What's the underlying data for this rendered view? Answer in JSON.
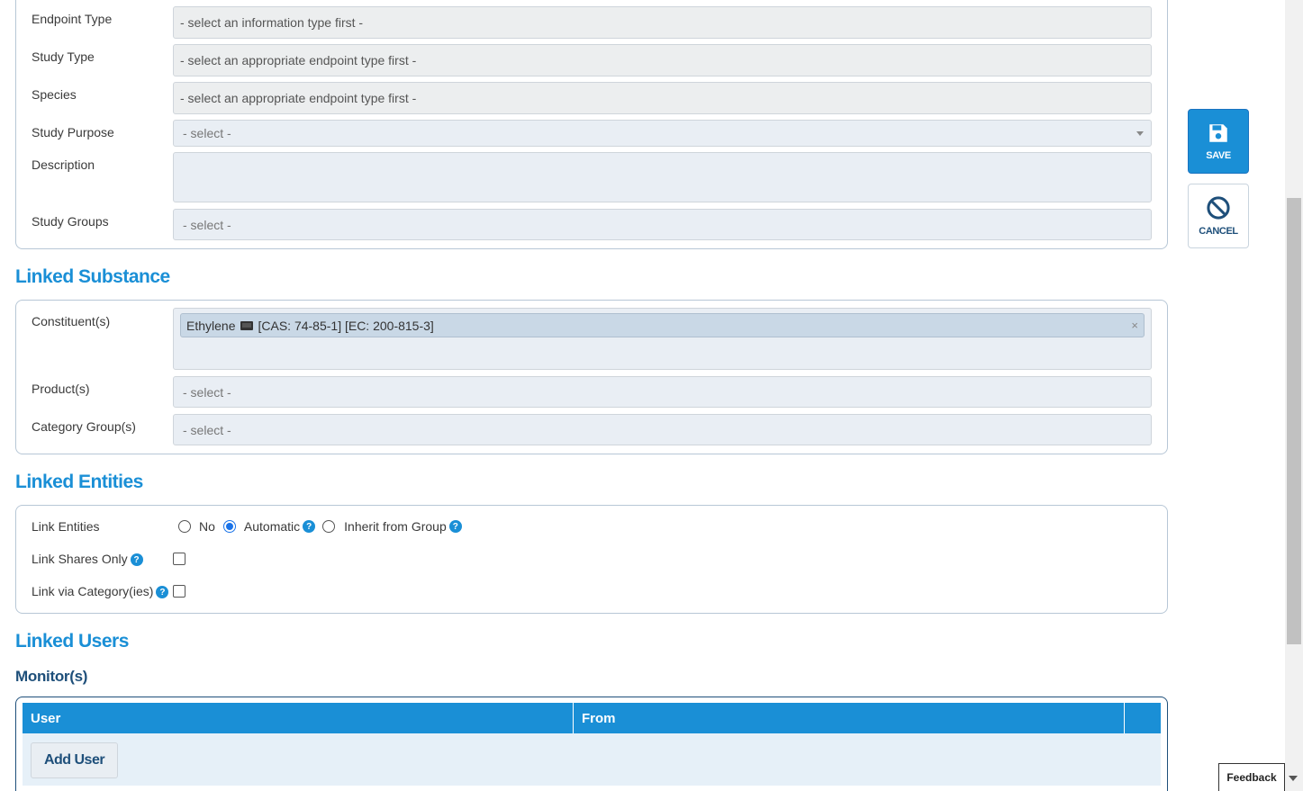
{
  "study_panel": {
    "endpoint_type": {
      "label": "Endpoint Type",
      "placeholder": "- select an information type first -"
    },
    "study_type": {
      "label": "Study Type",
      "placeholder": "- select an appropriate endpoint type first -"
    },
    "species": {
      "label": "Species",
      "placeholder": "- select an appropriate endpoint type first -"
    },
    "study_purpose": {
      "label": "Study Purpose",
      "placeholder": "- select -"
    },
    "description": {
      "label": "Description",
      "value": ""
    },
    "study_groups": {
      "label": "Study Groups",
      "placeholder": "- select -"
    }
  },
  "actions": {
    "save_label": "SAVE",
    "cancel_label": "CANCEL"
  },
  "linked_substance": {
    "title": "Linked Substance",
    "constituents": {
      "label": "Constituent(s)",
      "tag_name": "Ethylene",
      "tag_ids": "[CAS: 74-85-1] [EC: 200-815-3]",
      "remove": "×"
    },
    "products": {
      "label": "Product(s)",
      "placeholder": "- select -"
    },
    "category_groups": {
      "label": "Category Group(s)",
      "placeholder": "- select -"
    }
  },
  "linked_entities": {
    "title": "Linked Entities",
    "link_entities": {
      "label": "Link Entities",
      "options": [
        "No",
        "Automatic",
        "Inherit from Group"
      ],
      "selected": "Automatic"
    },
    "link_shares_only": {
      "label": "Link Shares Only",
      "checked": false
    },
    "link_via_categories": {
      "label": "Link via Category(ies)",
      "checked": false
    }
  },
  "linked_users": {
    "title": "Linked Users",
    "monitors": {
      "title": "Monitor(s)",
      "columns": [
        "User",
        "From",
        ""
      ],
      "add_label": "Add User"
    }
  },
  "feedback_label": "Feedback",
  "colors": {
    "accent": "#1a8fd6",
    "dark_heading": "#1e4f7a"
  }
}
